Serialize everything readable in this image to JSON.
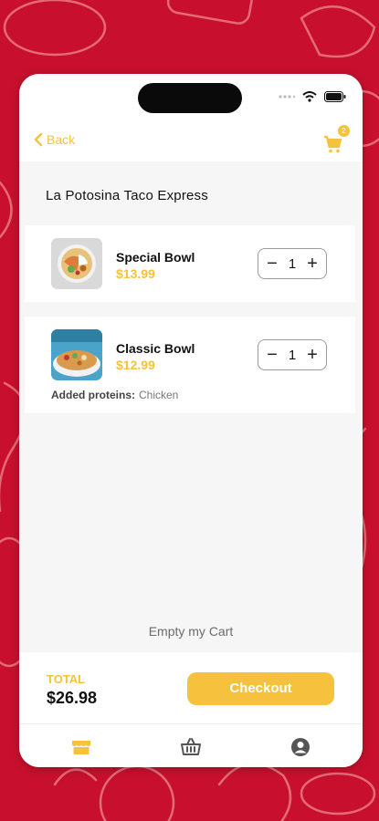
{
  "colors": {
    "accent": "#f6c23e",
    "background": "#c8102e",
    "doodle": "#e46a78"
  },
  "status_bar": {
    "icons": [
      "signal-dots-icon",
      "wifi-icon",
      "battery-icon"
    ]
  },
  "header": {
    "back_label": "Back",
    "cart_count": "2"
  },
  "restaurant_name": "La Potosina Taco Express",
  "items": [
    {
      "name": "Special Bowl",
      "price": "$13.99",
      "quantity": "1"
    },
    {
      "name": "Classic Bowl",
      "price": "$12.99",
      "quantity": "1",
      "proteins_label": "Added proteins:",
      "proteins_value": "Chicken"
    }
  ],
  "empty_cart_label": "Empty my Cart",
  "footer": {
    "total_label": "TOTAL",
    "total_value": "$26.98",
    "checkout_label": "Checkout"
  },
  "tabs": [
    {
      "icon": "store-icon",
      "active": true
    },
    {
      "icon": "basket-icon",
      "active": false
    },
    {
      "icon": "profile-icon",
      "active": false
    }
  ]
}
